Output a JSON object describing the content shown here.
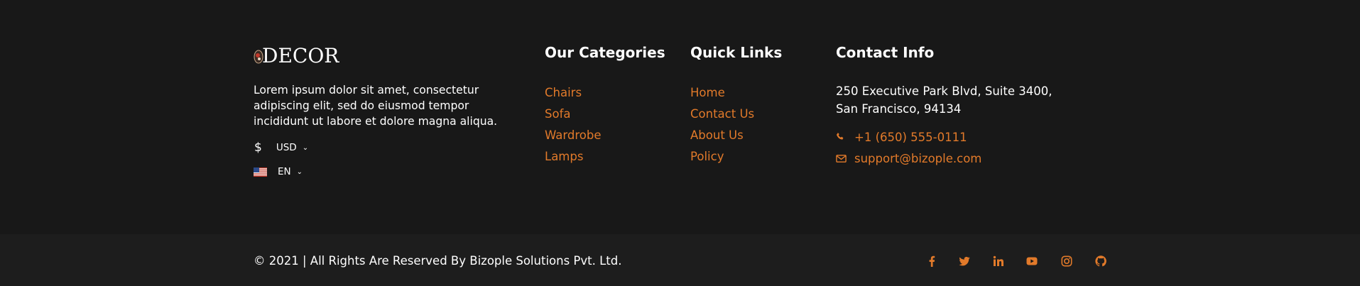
{
  "brand": {
    "logo_text": "DECOR",
    "about": "Lorem ipsum dolor sit amet, consectetur adipiscing elit, sed do eiusmod tempor incididunt ut labore et dolore magna aliqua.",
    "currency_symbol": "$",
    "currency": "USD",
    "language": "EN"
  },
  "categories": {
    "title": "Our Categories",
    "items": [
      "Chairs",
      "Sofa",
      "Wardrobe",
      "Lamps"
    ]
  },
  "quick_links": {
    "title": "Quick Links",
    "items": [
      "Home",
      "Contact Us",
      "About Us",
      "Policy"
    ]
  },
  "contact": {
    "title": "Contact Info",
    "address_line1": "250 Executive Park Blvd, Suite 3400,",
    "address_line2": "San Francisco, 94134",
    "phone": "+1 (650) 555-0111",
    "email": "support@bizople.com"
  },
  "bottom": {
    "copyright": "© 2021 | All Rights Are Reserved By Bizople Solutions Pvt. Ltd."
  },
  "social_icons": [
    "facebook-icon",
    "twitter-icon",
    "linkedin-icon",
    "youtube-icon",
    "instagram-icon",
    "github-icon"
  ],
  "colors": {
    "background": "#181818",
    "bottom_bar": "#1d1d1d",
    "accent": "#e27a2a",
    "text": "#ffffff"
  }
}
